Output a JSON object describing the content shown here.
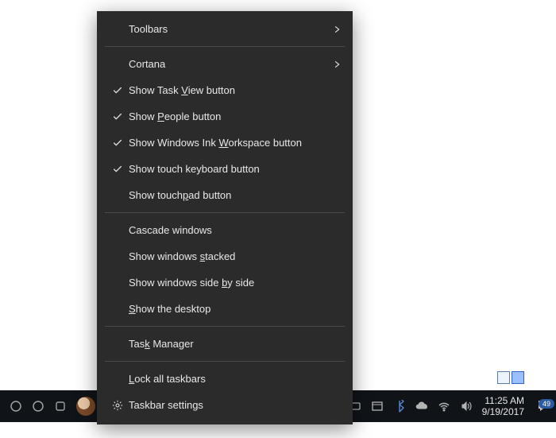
{
  "contextMenu": {
    "items": [
      {
        "label": "Toolbars",
        "submenu": true
      },
      {
        "separator": true
      },
      {
        "label": "Cortana",
        "submenu": true
      },
      {
        "label": "Show Task View button",
        "underline_idx": 10,
        "checked": true
      },
      {
        "label": "Show People button",
        "underline_idx": 5,
        "checked": true
      },
      {
        "label": "Show Windows Ink Workspace button",
        "underline_idx": 17,
        "checked": true
      },
      {
        "label": "Show touch keyboard button",
        "checked": true
      },
      {
        "label": "Show touchpad button",
        "underline_idx": 10
      },
      {
        "separator": true
      },
      {
        "label": "Cascade windows"
      },
      {
        "label": "Show windows stacked",
        "underline_idx": 13
      },
      {
        "label": "Show windows side by side",
        "underline_idx": 18
      },
      {
        "label": "Show the desktop",
        "underline_idx": 0
      },
      {
        "separator": true
      },
      {
        "label": "Task Manager",
        "underline_idx": 3
      },
      {
        "separator": true
      },
      {
        "label": "Lock all taskbars",
        "underline_idx": 0
      },
      {
        "label": "Taskbar settings",
        "icon": "gear"
      }
    ]
  },
  "taskbar": {
    "clock": {
      "time": "11:25 AM",
      "date": "9/19/2017"
    },
    "actionCenterCount": "49"
  }
}
